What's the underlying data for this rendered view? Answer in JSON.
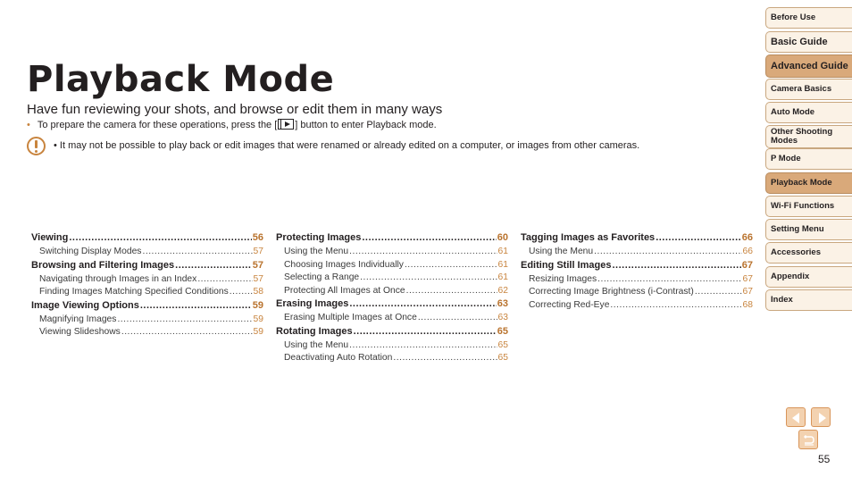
{
  "page": {
    "title": "Playback Mode",
    "subtitle": "Have fun reviewing your shots, and browse or edit them in many ways",
    "bullet_before": "To prepare the camera for these operations, press the [",
    "bullet_after": "] button to enter Playback mode.",
    "bullet_icon": "playback-button-icon",
    "caution_text": "• It may not be possible to play back or edit images that were renamed or already edited on a computer, or images from other cameras.",
    "page_number": "55"
  },
  "toc": {
    "columns": [
      [
        {
          "label": "Viewing",
          "page": "56",
          "level": "main"
        },
        {
          "label": "Switching Display Modes",
          "page": "57",
          "level": "sub"
        },
        {
          "label": "Browsing and Filtering Images",
          "page": "57",
          "level": "main"
        },
        {
          "label": "Navigating through Images in an Index",
          "page": "57",
          "level": "sub"
        },
        {
          "label": "Finding Images Matching Specified Conditions",
          "page": "58",
          "level": "sub"
        },
        {
          "label": "Image Viewing Options",
          "page": "59",
          "level": "main"
        },
        {
          "label": "Magnifying Images",
          "page": "59",
          "level": "sub"
        },
        {
          "label": "Viewing Slideshows",
          "page": "59",
          "level": "sub"
        }
      ],
      [
        {
          "label": "Protecting Images",
          "page": "60",
          "level": "main"
        },
        {
          "label": "Using the Menu",
          "page": "61",
          "level": "sub"
        },
        {
          "label": "Choosing Images Individually",
          "page": "61",
          "level": "sub"
        },
        {
          "label": "Selecting a Range",
          "page": "61",
          "level": "sub"
        },
        {
          "label": "Protecting All Images at Once",
          "page": "62",
          "level": "sub"
        },
        {
          "label": "Erasing Images",
          "page": "63",
          "level": "main"
        },
        {
          "label": "Erasing Multiple Images at Once",
          "page": "63",
          "level": "sub"
        },
        {
          "label": "Rotating Images",
          "page": "65",
          "level": "main"
        },
        {
          "label": "Using the Menu",
          "page": "65",
          "level": "sub"
        },
        {
          "label": "Deactivating Auto Rotation",
          "page": "65",
          "level": "sub"
        }
      ],
      [
        {
          "label": "Tagging Images as Favorites",
          "page": "66",
          "level": "main"
        },
        {
          "label": "Using the Menu",
          "page": "66",
          "level": "sub"
        },
        {
          "label": "Editing Still Images",
          "page": "67",
          "level": "main"
        },
        {
          "label": "Resizing Images",
          "page": "67",
          "level": "sub"
        },
        {
          "label": "Correcting Image Brightness (i-Contrast)",
          "page": "67",
          "level": "sub"
        },
        {
          "label": "Correcting Red-Eye",
          "page": "68",
          "level": "sub"
        }
      ]
    ]
  },
  "sidebar": {
    "tabs": [
      {
        "label": "Before Use",
        "active": false,
        "big": false
      },
      {
        "label": "Basic Guide",
        "active": false,
        "big": true
      },
      {
        "label": "Advanced Guide",
        "active": true,
        "big": true
      },
      {
        "label": "Camera Basics",
        "active": false,
        "big": false
      },
      {
        "label": "Auto Mode",
        "active": false,
        "big": false
      },
      {
        "label": "Other Shooting Modes",
        "active": false,
        "big": false
      },
      {
        "label": "P Mode",
        "active": false,
        "big": false
      },
      {
        "label": "Playback Mode",
        "active": true,
        "big": false
      },
      {
        "label": "Wi-Fi Functions",
        "active": false,
        "big": false
      },
      {
        "label": "Setting Menu",
        "active": false,
        "big": false
      },
      {
        "label": "Accessories",
        "active": false,
        "big": false
      },
      {
        "label": "Appendix",
        "active": false,
        "big": false
      },
      {
        "label": "Index",
        "active": false,
        "big": false
      }
    ]
  },
  "nav_buttons": {
    "prev": "previous-page-icon",
    "next": "next-page-icon",
    "back": "return-icon"
  },
  "colors": {
    "accent": "#c8843e",
    "tab_bg": "#fbf2e6",
    "tab_active": "#d9a97a"
  }
}
